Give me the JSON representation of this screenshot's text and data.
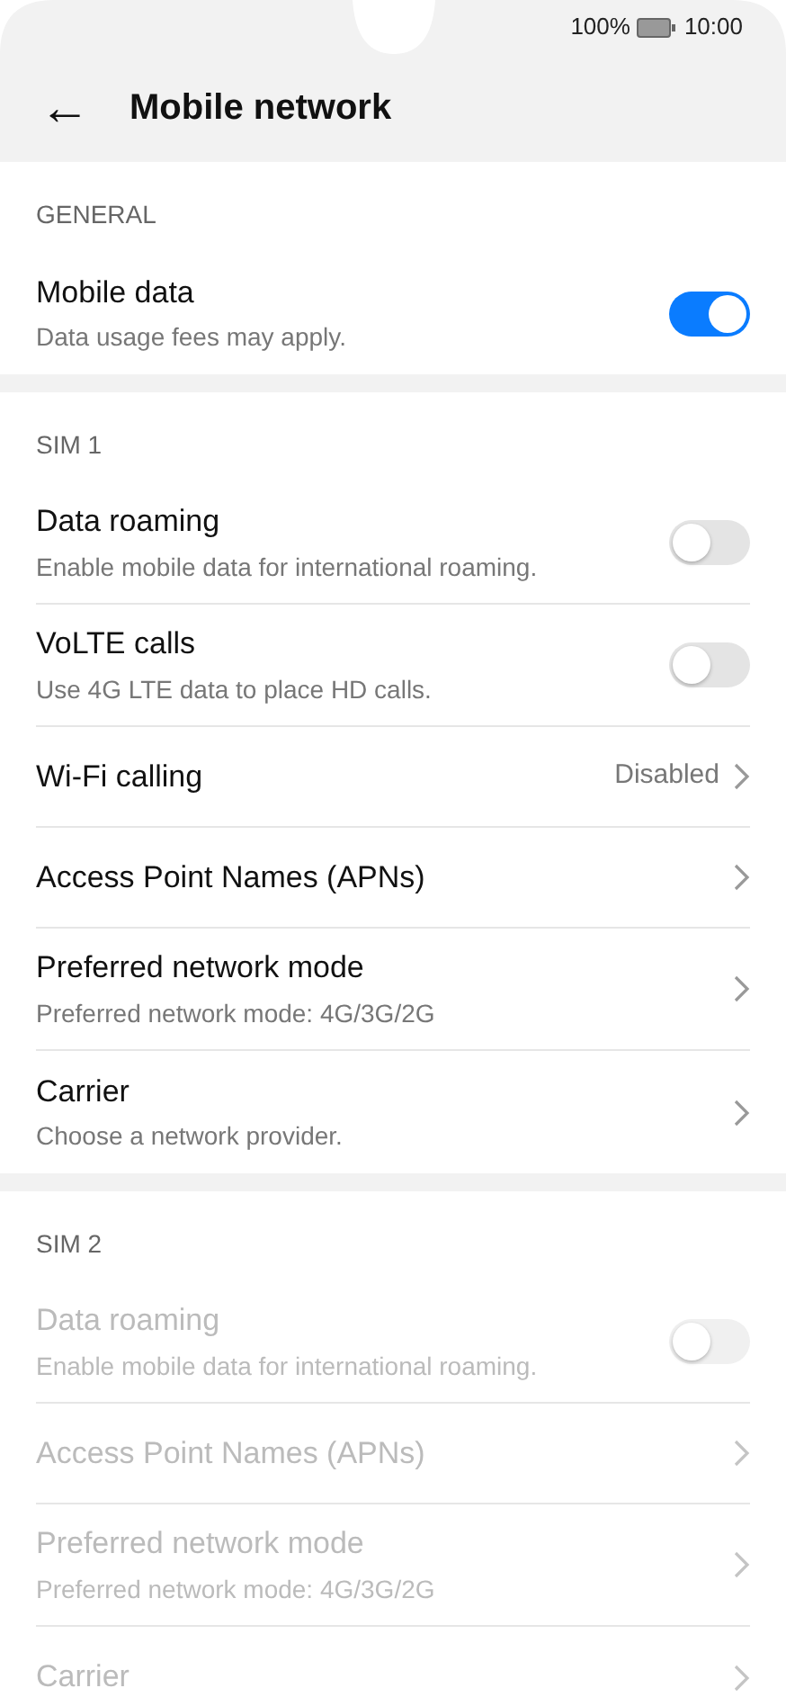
{
  "status_bar": {
    "battery": "100%",
    "time": "10:00"
  },
  "header": {
    "back": "←",
    "title": "Mobile network"
  },
  "sections": [
    {
      "title": "GENERAL",
      "disabled": false,
      "items": [
        {
          "kind": "toggle",
          "title": "Mobile data",
          "subtitle": "Data usage fees may apply.",
          "on": true
        }
      ]
    },
    {
      "title": "SIM 1",
      "disabled": false,
      "items": [
        {
          "kind": "toggle",
          "title": "Data roaming",
          "subtitle": "Enable mobile data for international roaming.",
          "on": false
        },
        {
          "kind": "toggle",
          "title": "VoLTE calls",
          "subtitle": "Use 4G LTE data to place HD calls.",
          "on": false
        },
        {
          "kind": "link",
          "title": "Wi-Fi calling",
          "value": "Disabled"
        },
        {
          "kind": "link",
          "title": "Access Point Names (APNs)"
        },
        {
          "kind": "link",
          "title": "Preferred network mode",
          "subtitle": "Preferred network mode: 4G/3G/2G"
        },
        {
          "kind": "link",
          "title": "Carrier",
          "subtitle": "Choose a network provider."
        }
      ]
    },
    {
      "title": "SIM 2",
      "disabled": true,
      "items": [
        {
          "kind": "toggle",
          "title": "Data roaming",
          "subtitle": "Enable mobile data for international roaming.",
          "on": false
        },
        {
          "kind": "link",
          "title": "Access Point Names (APNs)"
        },
        {
          "kind": "link",
          "title": "Preferred network mode",
          "subtitle": "Preferred network mode: 4G/3G/2G"
        },
        {
          "kind": "link",
          "title": "Carrier"
        }
      ]
    }
  ]
}
